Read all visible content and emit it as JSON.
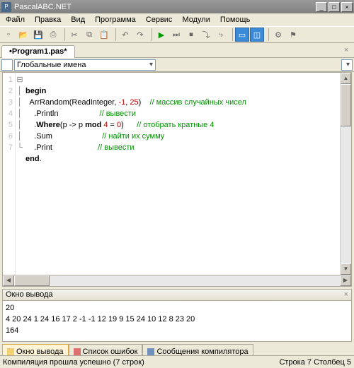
{
  "window": {
    "title": "PascalABC.NET",
    "min": "_",
    "max": "□",
    "close": "×"
  },
  "menu": {
    "items": [
      "Файл",
      "Правка",
      "Вид",
      "Программа",
      "Сервис",
      "Модули",
      "Помощь"
    ]
  },
  "tabs": {
    "file": "•Program1.pas*",
    "close": "×"
  },
  "scope": {
    "label": "Глобальные имена"
  },
  "gutter": {
    "lines": [
      "1",
      "2",
      "3",
      "4",
      "5",
      "6",
      "7"
    ]
  },
  "code": {
    "l1_kw": "begin",
    "l2a": "  ArrRandom(ReadInteger, ",
    "l2n1": "-1",
    "l2b": ", ",
    "l2n2": "25",
    "l2c": ")    ",
    "l2com": "// массив случайных чисел",
    "l3a": "    .Println                   ",
    "l3com": "// вывести",
    "l4a": "    .",
    "l4kw": "Where",
    "l4b": "(p -> p ",
    "l4kw2": "mod",
    "l4c": " ",
    "l4n1": "4",
    "l4d": " = ",
    "l4n2": "0",
    "l4e": ")      ",
    "l4com": "// отобрать кратные 4",
    "l5a": "    .Sum                       ",
    "l5com": "// найти их сумму",
    "l6a": "    .Print                     ",
    "l6com": "// вывести",
    "l7_kw": "end",
    "l7_dot": "."
  },
  "outputpane": {
    "title": "Окно вывода",
    "close": "×"
  },
  "output": {
    "line1": "20",
    "line2": "4 20 24 1 24 16 17 2 -1 -1 12 19 9 15 24 10 12 8 23 20",
    "line3": "164"
  },
  "btabs": {
    "t1": "Окно вывода",
    "t2": "Список ошибок",
    "t3": "Сообщения компилятора"
  },
  "status": {
    "left": "Компиляция прошла успешно (7 строк)",
    "right": "Строка  7 Столбец  5"
  }
}
